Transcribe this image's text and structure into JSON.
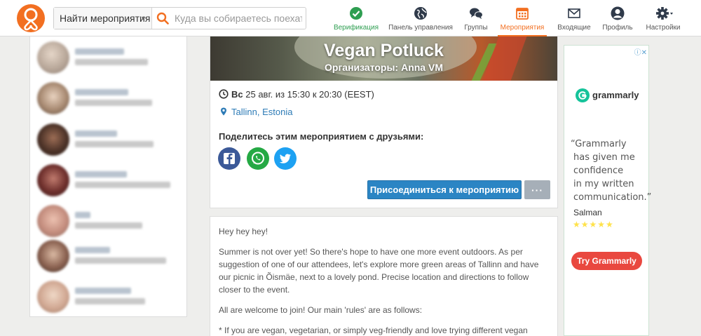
{
  "colors": {
    "brand": "#f26f21",
    "link": "#2d7bb6",
    "join": "#2b85c4",
    "verify": "#2e9e51",
    "ad_cta": "#e9483f"
  },
  "search": {
    "category": "Найти мероприятия",
    "placeholder": "Куда вы собираетесь поехать?",
    "value": ""
  },
  "nav": [
    {
      "label": "Верификация",
      "icon": "verified-check-icon"
    },
    {
      "label": "Панель управления",
      "icon": "globe-icon"
    },
    {
      "label": "Группы",
      "icon": "chat-bubbles-icon"
    },
    {
      "label": "Мероприятия",
      "icon": "calendar-icon",
      "active": true
    },
    {
      "label": "Входящие",
      "icon": "envelope-icon"
    },
    {
      "label": "Профиль",
      "icon": "user-icon"
    },
    {
      "label": "Настройки",
      "icon": "gear-icon"
    }
  ],
  "event": {
    "title": "Vegan Potluck",
    "organizers_label": "Организаторы:",
    "organizer": "Anna VM",
    "date_day": "Вс",
    "date_text": "25 авг. из 15:30 к 20:30 (EEST)",
    "location": "Tallinn, Estonia",
    "share_title": "Поделитесь этим мероприятием с друзьями:",
    "join_label": "Присоединиться к мероприятию",
    "more_label": "···"
  },
  "description": {
    "paragraphs": [
      "Hey hey hey!",
      "Summer is not over yet! So there's hope to have one more event outdoors. As per suggestion of one of our attendees, let's explore more green areas of Tallinn and have our picnic in Õismäe, next to a lovely pond. Precise location and directions to follow closer to the event.",
      "All are welcome to join! Our main 'rules' are as follows:",
      "* If you are vegan, vegetarian, or simply veg-friendly and love trying different vegan foods, you are more than welcome to join."
    ]
  },
  "ad": {
    "brand": "grammarly",
    "quote_lines": [
      "“Grammarly",
      "has given me",
      "confidence",
      "in my written",
      "communication.”"
    ],
    "author": "Salman",
    "stars": "★★★★★",
    "cta": "Try Grammarly",
    "badge": "ⓘ✕"
  }
}
